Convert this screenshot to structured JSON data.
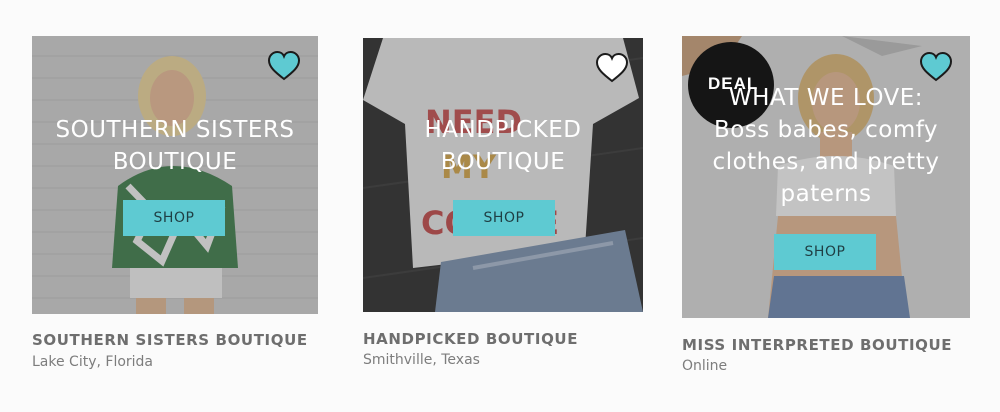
{
  "colors": {
    "accent": "#5ecad2",
    "heart_teal": "#5ecad2",
    "heart_white": "#ffffff"
  },
  "cards": [
    {
      "overlay": [
        "SOUTHERN SISTERS",
        "BOUTIQUE"
      ],
      "button": "SHOP",
      "heart": "filled-heart-icon",
      "name": "SOUTHERN SISTERS BOUTIQUE",
      "location": "Lake City, Florida"
    },
    {
      "overlay": [
        "HANDPICKED",
        "BOUTIQUE"
      ],
      "button": "SHOP",
      "heart": "white-heart-icon",
      "name": "HANDPICKED BOUTIQUE",
      "location": "Smithville, Texas"
    },
    {
      "badge": "DEAL",
      "overlay": [
        "WHAT WE LOVE:",
        "Boss babes, comfy",
        "clothes, and pretty",
        "paterns"
      ],
      "button": "SHOP",
      "heart": "filled-heart-icon",
      "name": "MISS INTERPRETED BOUTIQUE",
      "location": "Online"
    }
  ]
}
